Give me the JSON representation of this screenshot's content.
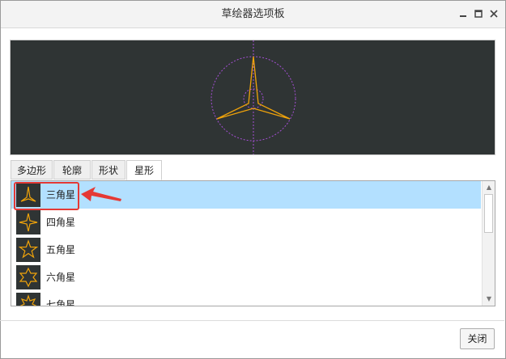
{
  "window": {
    "title": "草绘器选项板"
  },
  "tabs": [
    {
      "label": "多边形",
      "active": false
    },
    {
      "label": "轮廓",
      "active": false
    },
    {
      "label": "形状",
      "active": false
    },
    {
      "label": "星形",
      "active": true
    }
  ],
  "list": {
    "items": [
      {
        "label": "三角星",
        "icon": "triangle-star-icon",
        "selected": true
      },
      {
        "label": "四角星",
        "icon": "four-point-star-icon",
        "selected": false
      },
      {
        "label": "五角星",
        "icon": "five-point-star-icon",
        "selected": false
      },
      {
        "label": "六角星",
        "icon": "six-point-star-icon",
        "selected": false
      },
      {
        "label": "七角星",
        "icon": "seven-point-star-icon",
        "selected": false
      }
    ]
  },
  "footer": {
    "close_label": "关闭"
  },
  "colors": {
    "preview_bg": "#2f3434",
    "star_stroke": "#f0a30a",
    "circle_stroke": "#a64fd6",
    "selection": "#b3e0ff",
    "annotation": "#e53935"
  }
}
